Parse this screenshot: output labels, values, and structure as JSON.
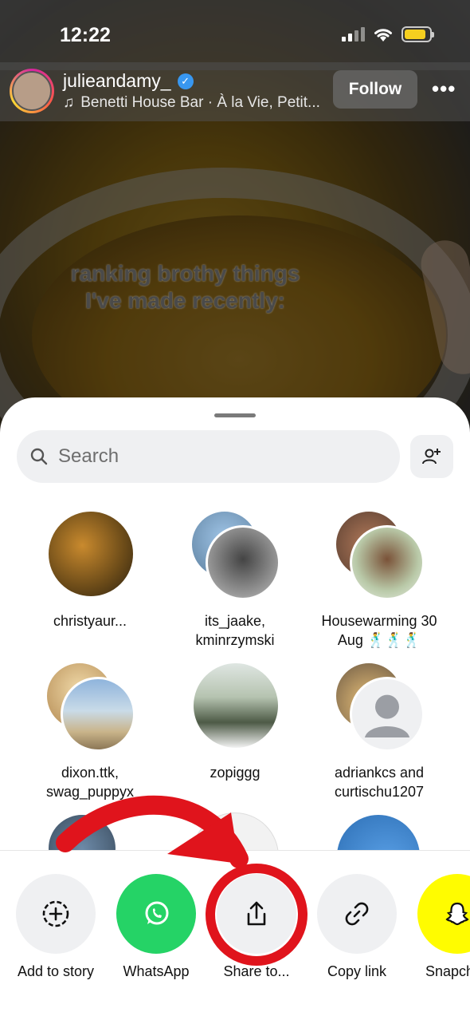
{
  "status_bar": {
    "time": "12:22",
    "battery_color": "#f5cf1f"
  },
  "post": {
    "username": "julieandamy_",
    "music": "Benetti House Bar · À la Vie, Petit...",
    "follow_label": "Follow",
    "caption_line1": "ranking brothy things",
    "caption_line2": "I've made recently:"
  },
  "share_sheet": {
    "search_placeholder": "Search",
    "contacts": [
      {
        "label": "christyaur...",
        "avatar": "single"
      },
      {
        "label": "its_jaake, kminrzymski",
        "avatar": "group"
      },
      {
        "label": "Housewarming 30 Aug 🕺🕺🕺",
        "avatar": "group"
      },
      {
        "label": "dixon.ttk, swag_puppyx",
        "avatar": "group"
      },
      {
        "label": "zopiggg",
        "avatar": "single"
      },
      {
        "label": "adriankcs and curtischu1207",
        "avatar": "group-placeholder"
      }
    ],
    "actions": [
      {
        "label": "Add to story",
        "icon": "add-story-icon",
        "color": "#eff0f2"
      },
      {
        "label": "WhatsApp",
        "icon": "whatsapp-icon",
        "color": "#25d366"
      },
      {
        "label": "Share to...",
        "icon": "share-icon",
        "color": "#eff0f2"
      },
      {
        "label": "Copy link",
        "icon": "link-icon",
        "color": "#eff0f2"
      },
      {
        "label": "Snapchat",
        "icon": "snapchat-icon",
        "color": "#fffc00"
      }
    ]
  },
  "annotation": {
    "color": "#e0141c"
  }
}
